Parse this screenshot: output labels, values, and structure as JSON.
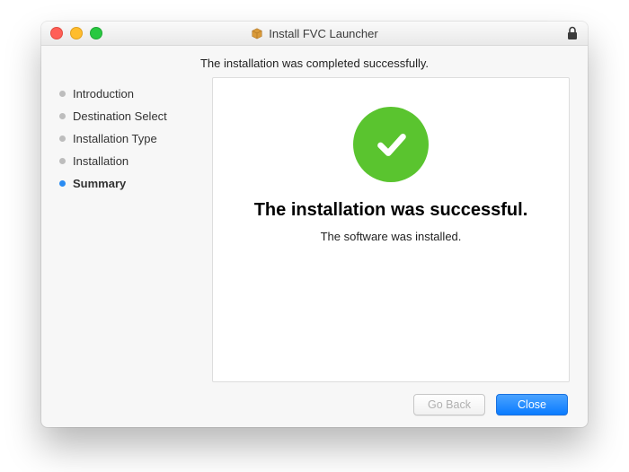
{
  "window": {
    "title": "Install FVC Launcher"
  },
  "header": {
    "message": "The installation was completed successfully."
  },
  "sidebar": {
    "items": [
      {
        "label": "Introduction"
      },
      {
        "label": "Destination Select"
      },
      {
        "label": "Installation Type"
      },
      {
        "label": "Installation"
      },
      {
        "label": "Summary"
      }
    ],
    "active_index": 4
  },
  "content": {
    "success_title": "The installation was successful.",
    "success_subtitle": "The software was installed."
  },
  "footer": {
    "back_label": "Go Back",
    "close_label": "Close"
  },
  "colors": {
    "accent": "#0a7bff",
    "success": "#5ac42f"
  }
}
